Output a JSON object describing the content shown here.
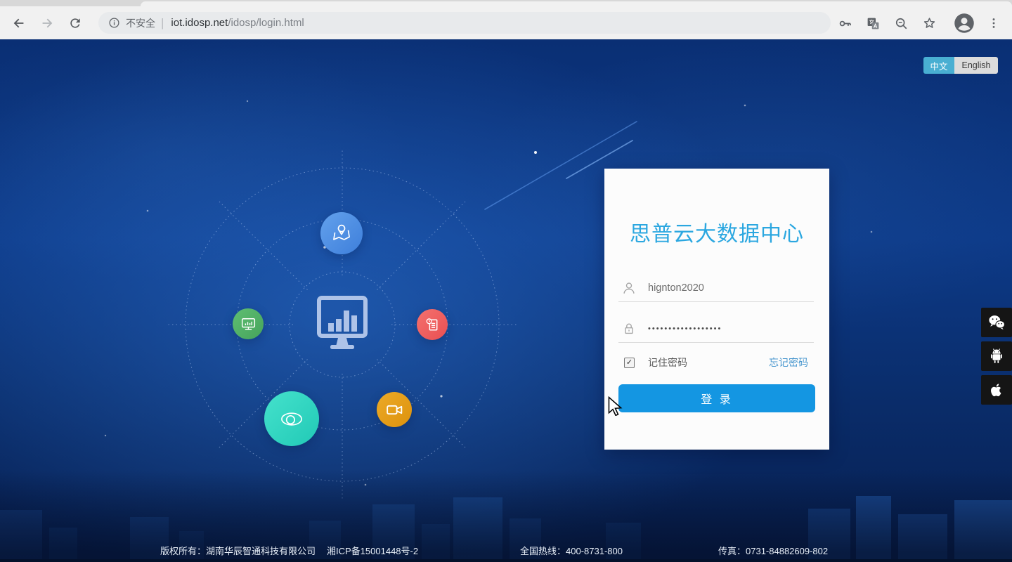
{
  "browser": {
    "security_label": "不安全",
    "separator": "|",
    "url_host": "iot.idosp.net",
    "url_path": "/idosp/login.html"
  },
  "language_toggle": {
    "chinese_label": "中文",
    "english_label": "English",
    "active": "chinese"
  },
  "login": {
    "title": "思普云大数据中心",
    "username_value": "hignton2020",
    "password_mask": "••••••••••••••••••",
    "remember_label": "记住密码",
    "remember_checked": "✓",
    "forgot_password_label": "忘记密码",
    "login_button_label": "登 录"
  },
  "footer": {
    "copyright": "版权所有：湖南华辰智通科技有限公司",
    "icp": "湘ICP备15001448号-2",
    "hotline": "全国热线：400-8731-800",
    "fax": "传真：0731-84882609-802"
  },
  "side_apps": [
    "wechat",
    "android",
    "apple"
  ],
  "diagram": {
    "center_icon": "dashboard-monitor",
    "nodes": [
      "map-location",
      "device-monitor",
      "report-document",
      "eye-monitoring",
      "video-camera"
    ]
  },
  "colors": {
    "accent_button": "#1496E2",
    "title_cyan": "#2BA7E0",
    "toggle_active": "#49AFD2",
    "node_blue": "#4E8FE0",
    "node_green": "#54B368",
    "node_red": "#F15E5E",
    "node_teal": "#2FD9C4",
    "node_orange": "#E49C16",
    "page_bg": "#0D3A88"
  }
}
